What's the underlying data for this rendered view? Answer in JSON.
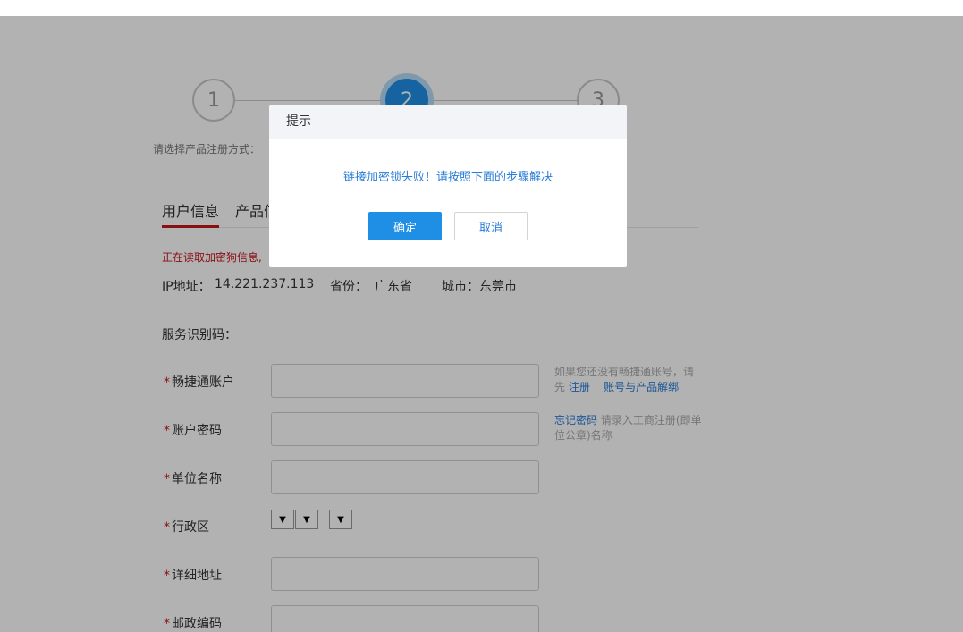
{
  "steps": [
    "1",
    "2",
    "3"
  ],
  "step_hint": "请选择产品注册方式：",
  "tabs": [
    "用户信息",
    "产品信"
  ],
  "reading_text": "正在读取加密狗信息,",
  "info": {
    "ip_label": "IP地址：",
    "ip_value": "14.221.237.113",
    "province_label": "省份：",
    "province_value": "广东省",
    "city_label": "城市：",
    "city_value": "东莞市"
  },
  "service_label": "服务识别码：",
  "form": {
    "required_mark": "*",
    "fields": [
      "畅捷通账户",
      "账户密码",
      "单位名称",
      "行政区",
      "详细地址",
      "邮政编码"
    ],
    "select_arrow": "▼"
  },
  "help": {
    "account_text_1": "如果您还没有畅捷通账号，请先",
    "register_link": "注册",
    "unbind_link": "账号与产品解绑",
    "forgot_link": "忘记密码",
    "company_hint": "请录入工商注册(即单位公章)名称"
  },
  "dialog": {
    "title": "提示",
    "message": "链接加密锁失败！请按照下面的步骤解决",
    "ok_label": "确定",
    "cancel_label": "取消"
  },
  "colors": {
    "accent": "#1f8ee5",
    "link": "#2a7dd6",
    "required": "#c4161c",
    "overlay": "rgba(0,0,0,0.30)"
  }
}
